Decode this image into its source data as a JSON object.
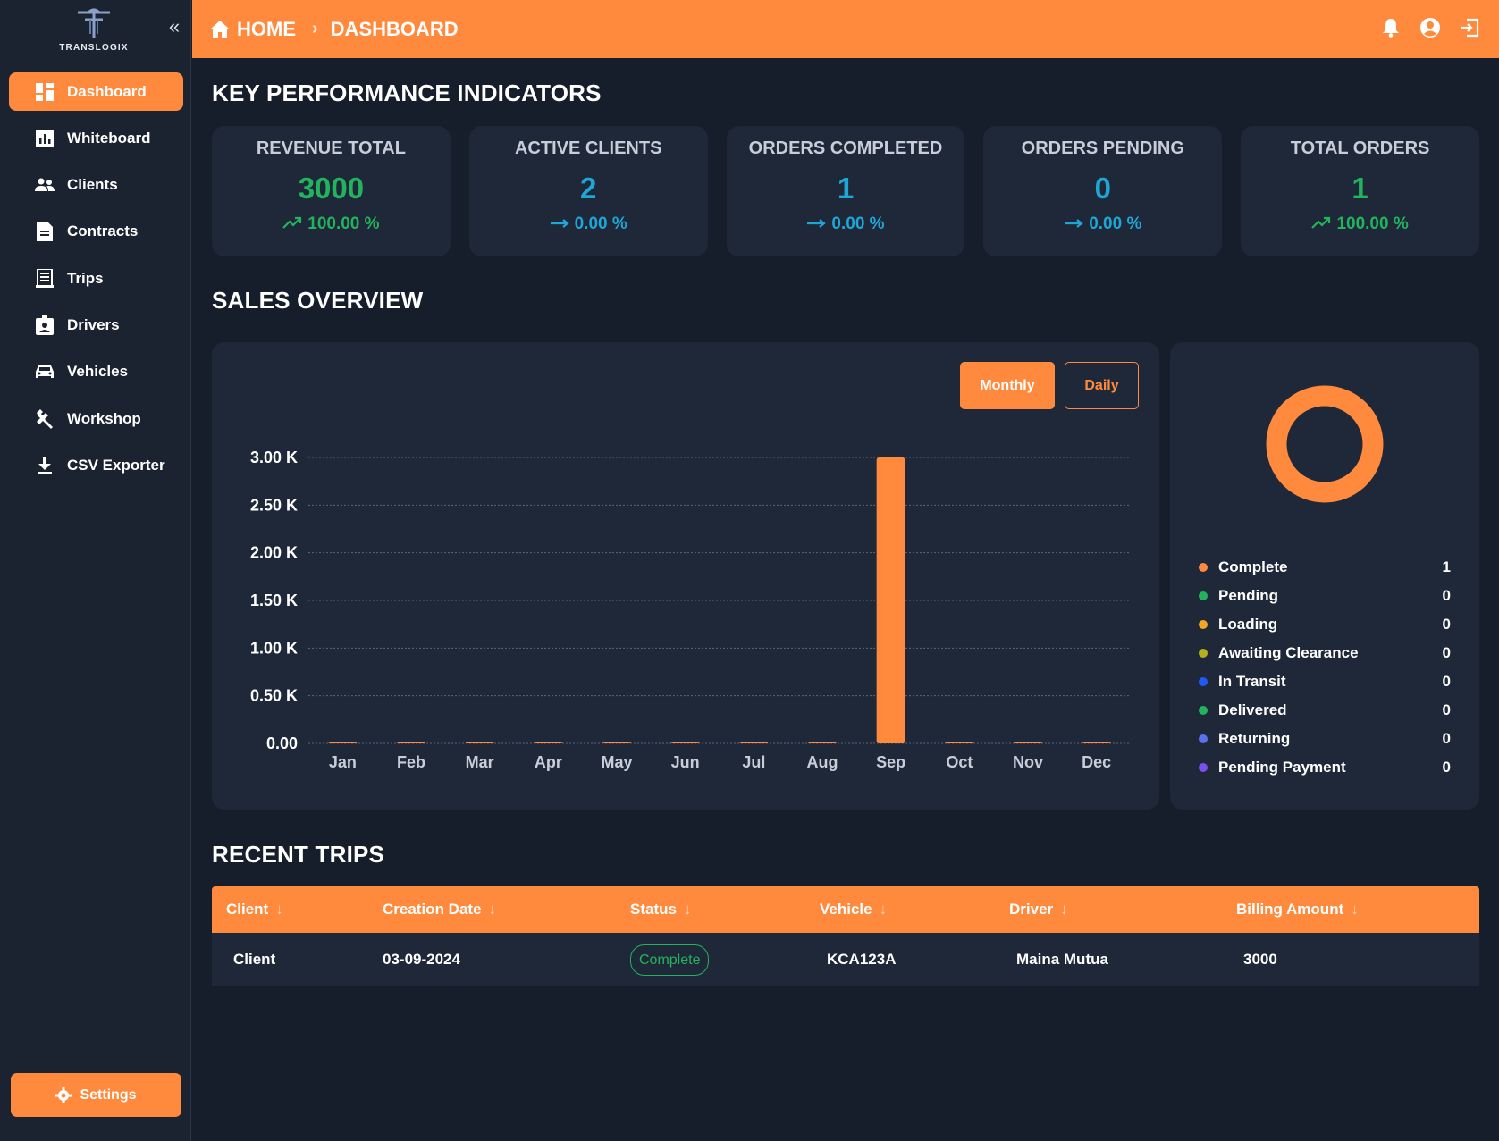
{
  "brand": {
    "logo_text": "TRANSLOGIX"
  },
  "sidebar": {
    "collapse_icon": "double-chevron-left-icon",
    "items": [
      {
        "label": "Dashboard",
        "icon": "dashboard-icon",
        "active": true
      },
      {
        "label": "Whiteboard",
        "icon": "bar-chart-icon",
        "active": false
      },
      {
        "label": "Clients",
        "icon": "people-icon",
        "active": false
      },
      {
        "label": "Contracts",
        "icon": "document-icon",
        "active": false
      },
      {
        "label": "Trips",
        "icon": "receipt-icon",
        "active": false
      },
      {
        "label": "Drivers",
        "icon": "badge-icon",
        "active": false
      },
      {
        "label": "Vehicles",
        "icon": "car-icon",
        "active": false
      },
      {
        "label": "Workshop",
        "icon": "wrench-icon",
        "active": false
      },
      {
        "label": "CSV Exporter",
        "icon": "download-icon",
        "active": false
      }
    ],
    "settings_label": "Settings"
  },
  "topbar": {
    "home": "HOME",
    "separator": "›",
    "current": "DASHBOARD",
    "icons": [
      "bell-icon",
      "account-icon",
      "logout-icon"
    ]
  },
  "kpi": {
    "title": "KEY PERFORMANCE INDICATORS",
    "cards": [
      {
        "label": "REVENUE TOTAL",
        "value": "3000",
        "change": "100.00 %",
        "trend": "up",
        "color": "#22b35e"
      },
      {
        "label": "ACTIVE CLIENTS",
        "value": "2",
        "change": "0.00 %",
        "trend": "flat",
        "color": "#1ea6d6"
      },
      {
        "label": "ORDERS COMPLETED",
        "value": "1",
        "change": "0.00 %",
        "trend": "flat",
        "color": "#1ea6d6"
      },
      {
        "label": "ORDERS PENDING",
        "value": "0",
        "change": "0.00 %",
        "trend": "flat",
        "color": "#1ea6d6"
      },
      {
        "label": "TOTAL ORDERS",
        "value": "1",
        "change": "100.00 %",
        "trend": "up",
        "color": "#22b35e"
      }
    ]
  },
  "sales": {
    "title": "SALES OVERVIEW",
    "monthly_label": "Monthly",
    "daily_label": "Daily"
  },
  "chart_data": {
    "type": "bar",
    "categories": [
      "Jan",
      "Feb",
      "Mar",
      "Apr",
      "May",
      "Jun",
      "Jul",
      "Aug",
      "Sep",
      "Oct",
      "Nov",
      "Dec"
    ],
    "values": [
      0,
      0,
      0,
      0,
      0,
      0,
      0,
      0,
      3000,
      0,
      0,
      0
    ],
    "ylim": [
      0,
      3000
    ],
    "yticks": [
      "0.00",
      "0.50 K",
      "1.00 K",
      "1.50 K",
      "2.00 K",
      "2.50 K",
      "3.00 K"
    ],
    "grid": true,
    "color": "#ff8a3d"
  },
  "status_breakdown": {
    "ring_color": "#ff8a3d",
    "items": [
      {
        "label": "Complete",
        "count": "1",
        "color": "#ff8a3d"
      },
      {
        "label": "Pending",
        "count": "0",
        "color": "#22b35e"
      },
      {
        "label": "Loading",
        "count": "0",
        "color": "#f5a623"
      },
      {
        "label": "Awaiting Clearance",
        "count": "0",
        "color": "#b5b01e"
      },
      {
        "label": "In Transit",
        "count": "0",
        "color": "#1e5bf5"
      },
      {
        "label": "Delivered",
        "count": "0",
        "color": "#22b35e"
      },
      {
        "label": "Returning",
        "count": "0",
        "color": "#5c6ff0"
      },
      {
        "label": "Pending Payment",
        "count": "0",
        "color": "#7a4ff0"
      }
    ]
  },
  "recent_trips": {
    "title": "RECENT TRIPS",
    "columns": [
      "Client",
      "Creation Date",
      "Status",
      "Vehicle",
      "Driver",
      "Billing Amount"
    ],
    "rows": [
      {
        "client": "Client",
        "date": "03-09-2024",
        "status": "Complete",
        "vehicle": "KCA123A",
        "driver": "Maina Mutua",
        "amount": "3000"
      }
    ]
  }
}
